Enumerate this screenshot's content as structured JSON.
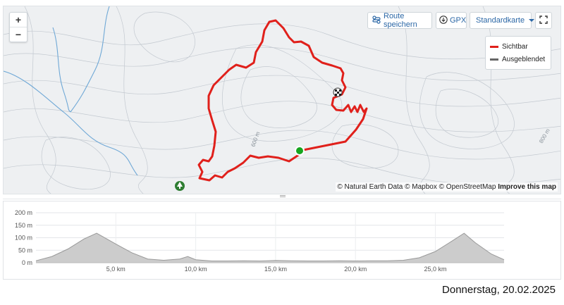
{
  "map": {
    "zoom_in": "+",
    "zoom_out": "−",
    "toolbar": {
      "save_route": "Route speichern",
      "gpx": "GPX",
      "map_style": "Standardkarte"
    },
    "legend": {
      "visible": {
        "label": "Sichtbar",
        "color": "#e0201b"
      },
      "hidden": {
        "label": "Ausgeblendet",
        "color": "#666666"
      }
    },
    "contour_labels": [
      "600 m",
      "800 m"
    ],
    "attribution": {
      "text": "© Natural Earth Data © Mapbox © OpenStreetMap",
      "improve": "Improve this map"
    },
    "colors": {
      "route": "#e0201b",
      "river": "#6fa8d6",
      "start": "#16a51f",
      "tree_marker": "#2e7d32"
    }
  },
  "chart_data": {
    "type": "area",
    "x": [
      0,
      1,
      2,
      3,
      3.8,
      5,
      6,
      7,
      8,
      9,
      9.5,
      10,
      11,
      12,
      13,
      14,
      15,
      16,
      17,
      18,
      19,
      20,
      21,
      22,
      23,
      24,
      25,
      26,
      26.8,
      27.5,
      28.5,
      29.3
    ],
    "y": [
      8,
      25,
      55,
      95,
      118,
      75,
      40,
      15,
      10,
      15,
      25,
      12,
      7,
      7,
      8,
      7,
      9,
      8,
      7,
      7,
      8,
      7,
      8,
      8,
      10,
      20,
      45,
      85,
      118,
      80,
      35,
      12
    ],
    "xticks": [
      "5,0 km",
      "10,0 km",
      "15,0 km",
      "20,0 km",
      "25,0 km"
    ],
    "xtick_values": [
      5,
      10,
      15,
      20,
      25
    ],
    "yticks": [
      "0 m",
      "50 m",
      "100 m",
      "150 m",
      "200 m"
    ],
    "ytick_values": [
      0,
      50,
      100,
      150,
      200
    ],
    "xlim": [
      0,
      29.3
    ],
    "ylim": [
      0,
      200
    ],
    "grid": true,
    "fill_color": "#cccccc",
    "line_color": "#999999"
  },
  "footer": {
    "date": "Donnerstag, 20.02.2025"
  }
}
